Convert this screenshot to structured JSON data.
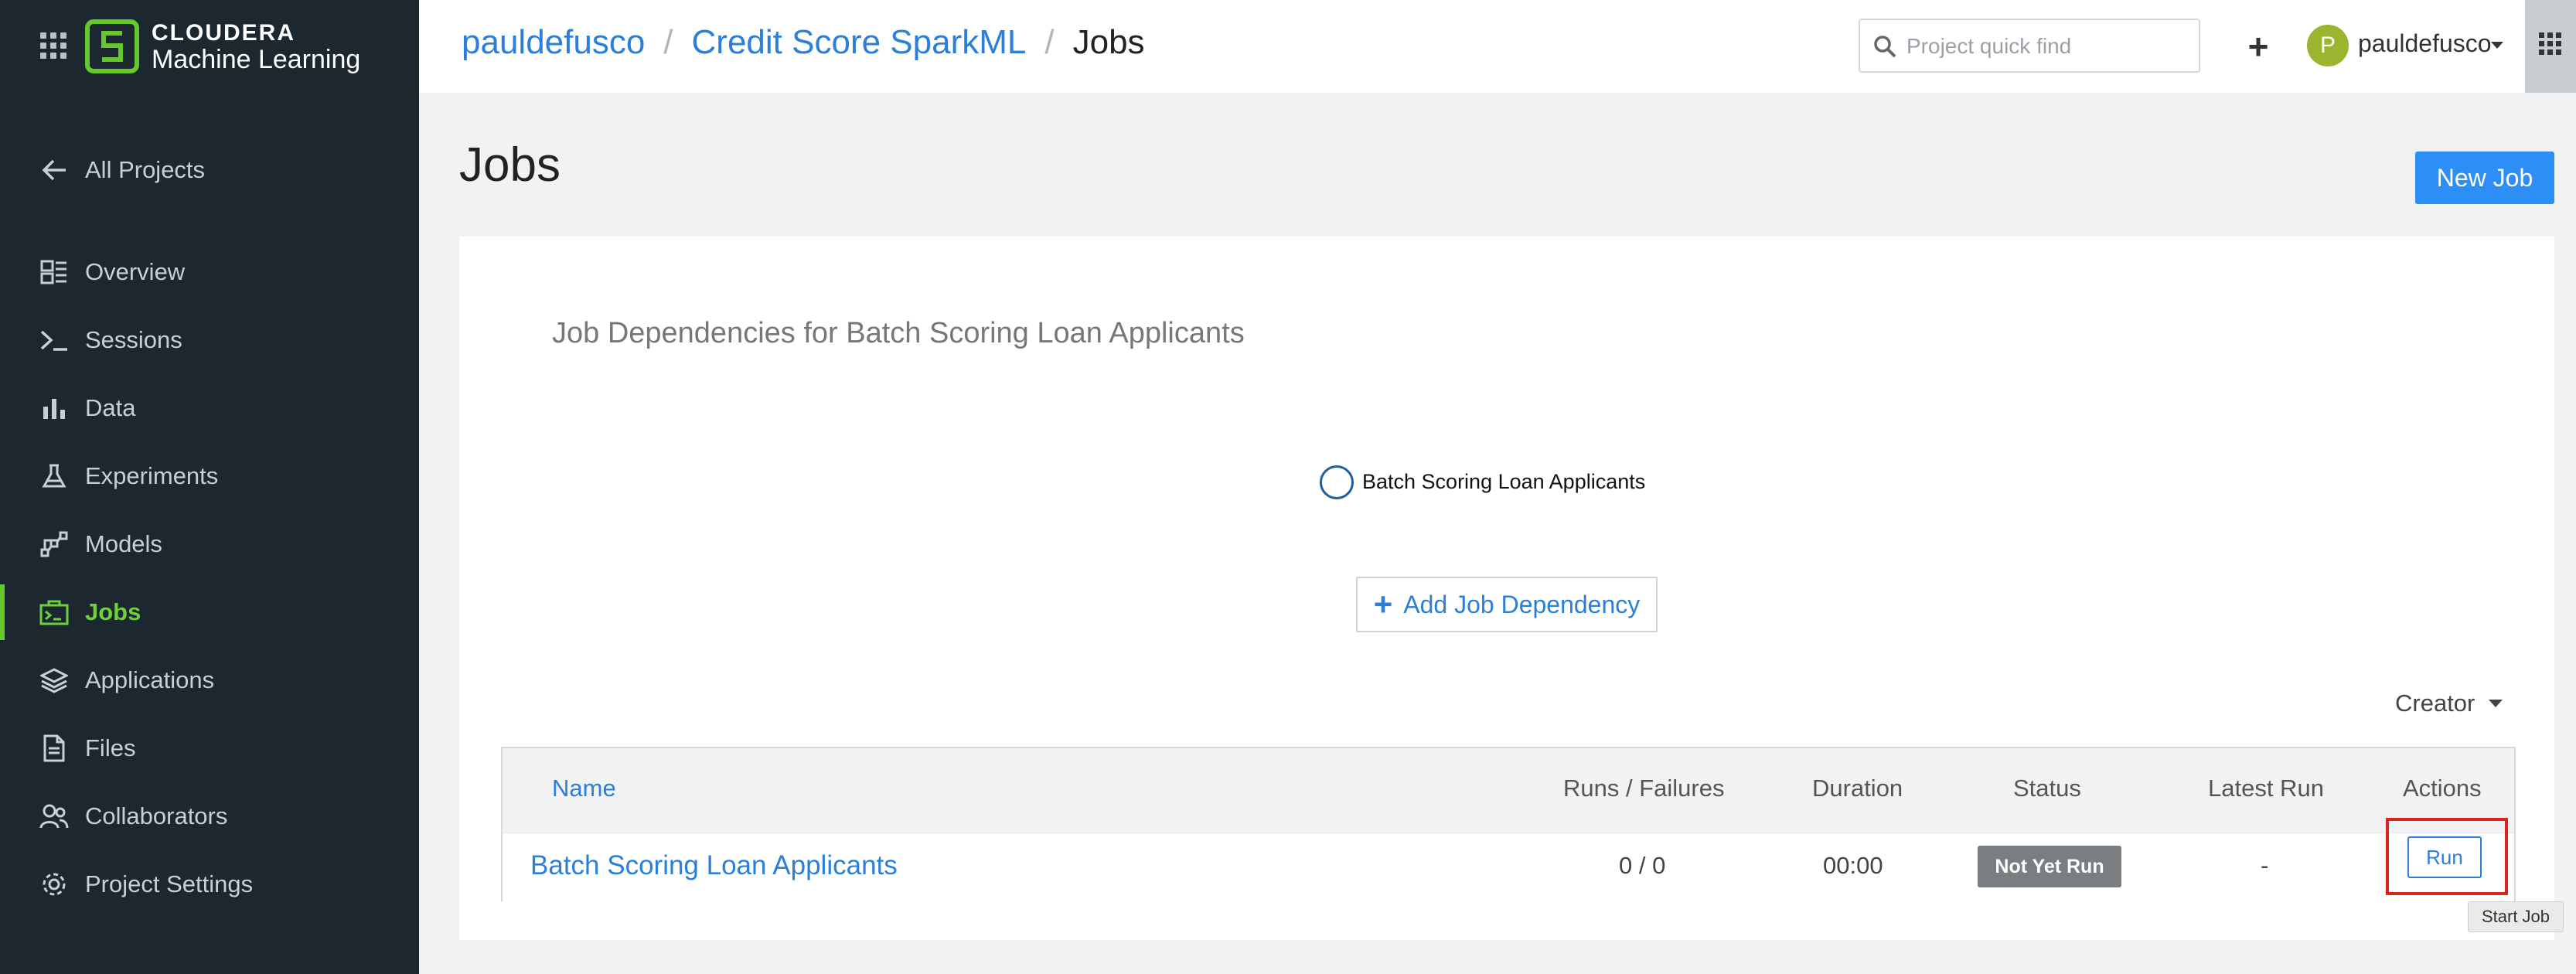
{
  "brand": {
    "name": "CLOUDERA",
    "product": "Machine Learning",
    "logo_icon": "cloudera-logo-icon",
    "accent": "#65c82c"
  },
  "sidebar": {
    "back": {
      "label": "All Projects",
      "icon": "arrow-left-icon"
    },
    "items": [
      {
        "label": "Overview",
        "icon": "overview-icon"
      },
      {
        "label": "Sessions",
        "icon": "terminal-icon"
      },
      {
        "label": "Data",
        "icon": "bar-chart-icon"
      },
      {
        "label": "Experiments",
        "icon": "flask-icon"
      },
      {
        "label": "Models",
        "icon": "models-icon"
      },
      {
        "label": "Jobs",
        "icon": "jobs-icon",
        "active": true
      },
      {
        "label": "Applications",
        "icon": "layers-icon"
      },
      {
        "label": "Files",
        "icon": "file-icon"
      },
      {
        "label": "Collaborators",
        "icon": "users-icon"
      },
      {
        "label": "Project Settings",
        "icon": "gear-icon"
      }
    ]
  },
  "header": {
    "breadcrumb": [
      "pauldefusco",
      "Credit Score SparkML",
      "Jobs"
    ],
    "search": {
      "placeholder": "Project quick find",
      "value": ""
    },
    "add_label": "+",
    "user": {
      "initial": "P",
      "name": "pauldefusco",
      "avatar_color": "#9cb52e"
    }
  },
  "main": {
    "title": "Jobs",
    "new_job_label": "New Job",
    "dependencies": {
      "title": "Job Dependencies for Batch Scoring Loan Applicants",
      "node_label": "Batch Scoring Loan Applicants",
      "add_label": "Add Job Dependency"
    },
    "filter_label": "Creator",
    "table": {
      "columns": [
        "Name",
        "Runs / Failures",
        "Duration",
        "Status",
        "Latest Run",
        "Actions"
      ],
      "rows": [
        {
          "name": "Batch Scoring Loan Applicants",
          "runs_failures": "0 / 0",
          "duration": "00:00",
          "status": "Not Yet Run",
          "latest_run": "-",
          "action": "Run"
        }
      ]
    },
    "tooltip": "Start Job"
  }
}
